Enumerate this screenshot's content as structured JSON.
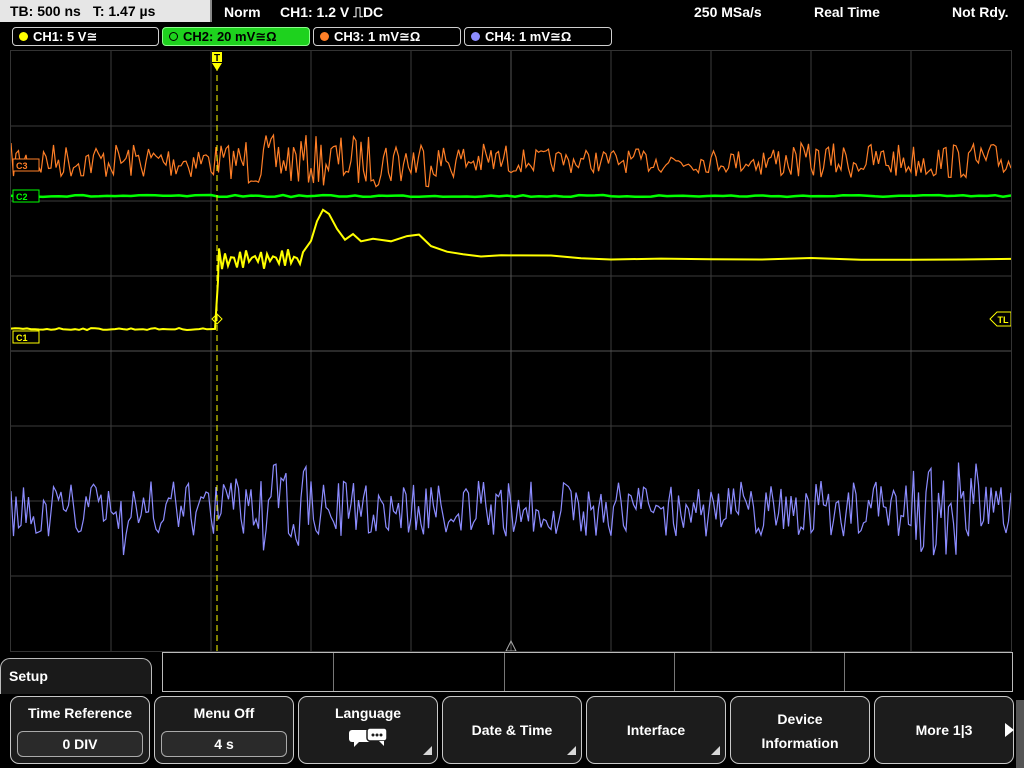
{
  "topbar": {
    "timebase": "TB: 500 ns",
    "trigger_time": "T: 1.47 µs",
    "trigger_mode": "Norm",
    "trigger_info": "CH1: 1.2 V ⎍DC",
    "sample_rate": "250 MSa/s",
    "acq_mode": "Real Time",
    "status": "Not Rdy."
  },
  "channels": [
    {
      "label": "CH1: 5 V≅",
      "color": "#ffff00",
      "active": false
    },
    {
      "label": "CH2: 20 mV≅Ω",
      "color": "#00ff00",
      "active": true
    },
    {
      "label": "CH3: 1 mV≅Ω",
      "color": "#ff7f27",
      "active": false
    },
    {
      "label": "CH4: 1 mV≅Ω",
      "color": "#8c8cff",
      "active": false
    }
  ],
  "markers": {
    "trigger_position": "T",
    "trigger_level": "TL",
    "ch1_marker": "C1",
    "ch2_marker": "C2",
    "ch3_marker": "C3"
  },
  "colors": {
    "ch1": "#ffff00",
    "ch2": "#00ff00",
    "ch3": "#ff7f27",
    "ch4": "#8c8cff",
    "grid": "#3c3c3c",
    "trigger_marker": "#ffff00"
  },
  "menu": {
    "title": "Setup",
    "softkeys": [
      {
        "label": "Time Reference",
        "value": "0 DIV"
      },
      {
        "label": "Menu Off",
        "value": "4 s"
      },
      {
        "label": "Language",
        "icon": "speech-bubbles-icon"
      },
      {
        "label": "Date & Time"
      },
      {
        "label": "Interface"
      },
      {
        "label_line1": "Device",
        "label_line2": "Information"
      },
      {
        "label": "More 1|3",
        "icon": "chevron-right-icon"
      }
    ]
  }
}
